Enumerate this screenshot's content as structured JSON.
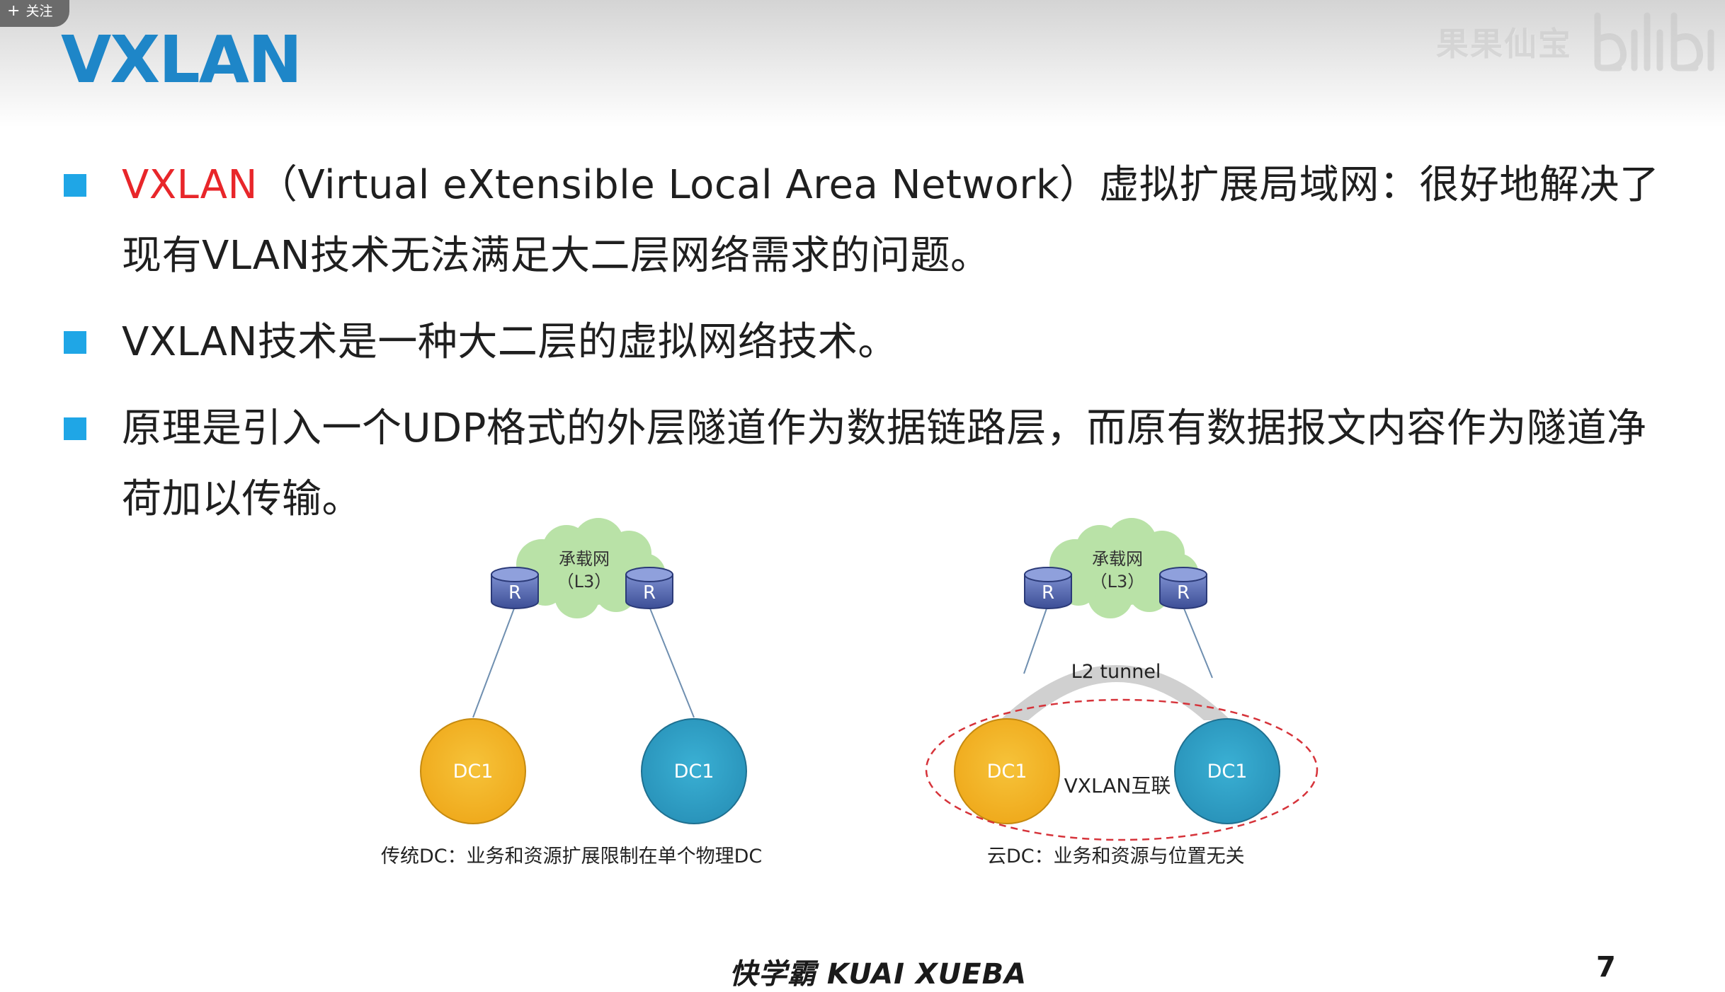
{
  "overlay": {
    "follow_label": "关注"
  },
  "slide": {
    "title": "VXLAN",
    "watermark": "果果仙宝",
    "bullets": [
      {
        "lines": [
          [
            "VXLAN",
            "（Virtual eXtensible Local Area Network）虚拟扩展局域网：很好地解决了"
          ],
          [
            "现有VLAN技术无法满足大二层网络需求的问题。"
          ]
        ]
      },
      {
        "lines": [
          [
            "VXLAN技术是一种大二层的虚拟网络技术。"
          ]
        ]
      },
      {
        "lines": [
          [
            "原理是引入一个UDP格式的外层隧道作为数据链路层，而原有数据报文内容作为隧道净"
          ],
          [
            "荷加以传输。"
          ]
        ]
      }
    ],
    "diagram_left": {
      "cloud_line1": "承载网",
      "cloud_line2": "（L3）",
      "router_label": "R",
      "dc_label": "DC1",
      "caption": "传统DC：业务和资源扩展限制在单个物理DC"
    },
    "diagram_right": {
      "cloud_line1": "承载网",
      "cloud_line2": "（L3）",
      "router_label": "R",
      "tunnel_label": "L2 tunnel",
      "dc_label": "DC1",
      "interconnect_label": "VXLAN互联",
      "caption": "云DC：业务和资源与位置无关"
    },
    "footer_brand": "快学霸 KUAI XUEBA",
    "page_number": "7"
  },
  "colors": {
    "title": "#1e86c8",
    "bullet": "#1fa6e6",
    "highlight": "#e8262a",
    "dc_orange": "#f2b01e",
    "dc_teal": "#2f9fc6",
    "router": "#4a5fa8",
    "cloud": "#b9e2a7",
    "tunnel": "#d0d0d0",
    "dashed_ring": "#d6333a"
  },
  "icons": [
    "plus-icon",
    "cloud-icon",
    "router-icon",
    "datacenter-icon"
  ]
}
